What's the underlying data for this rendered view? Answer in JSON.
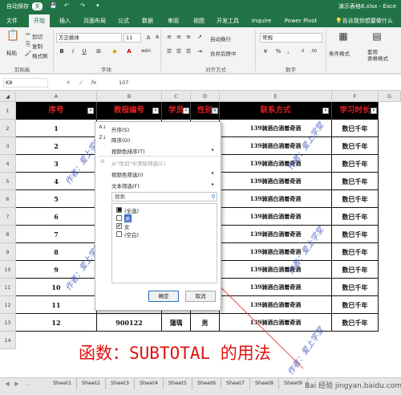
{
  "titlebar": {
    "autosave": "自动保存",
    "autosave_state": "关",
    "filename": "演示表格6.xlsx  -  Exce",
    "window": [
      "—",
      "□"
    ]
  },
  "ribbon_tabs": [
    "文件",
    "开始",
    "插入",
    "页面布局",
    "公式",
    "数据",
    "审阅",
    "视图",
    "开发工具",
    "Inquire",
    "Power Pivot"
  ],
  "active_tab": "开始",
  "tell_me": "告诉我你想要做什么",
  "ribbon": {
    "paste": "粘贴",
    "cut": "剪切",
    "copy": "复制",
    "format_painter": "格式刷",
    "clipboard": "剪贴板",
    "font_name": "方正姚体",
    "font_size": "11",
    "font_group": "字体",
    "wrap_text": "自动换行",
    "merge_center": "合并后居中",
    "align_group": "对齐方式",
    "number_format": "常规",
    "number_group": "数字",
    "conditional_format": "条件格式",
    "format_as_table": "套用\n表格格式",
    "bold": "B",
    "italic": "I",
    "underline": "U",
    "wen": "wén",
    "percent": "%",
    "comma": "，"
  },
  "formula_bar": {
    "name_box": "K8",
    "value": "107",
    "cancel": "✕",
    "enter": "✓",
    "fx": "fx"
  },
  "columns": [
    "A",
    "B",
    "C",
    "D",
    "E",
    "F",
    "G"
  ],
  "header_row": [
    "序号",
    "教程编号",
    "学员",
    "性别",
    "联系方式",
    "学习时长"
  ],
  "rows": [
    {
      "num": "1",
      "seq": "1",
      "contact": "139骑酒白酒着奇酒",
      "time": "数巳千年"
    },
    {
      "num": "2",
      "seq": "2",
      "contact": "139骑酒白酒着奇酒",
      "time": "数巳千年"
    },
    {
      "num": "3",
      "seq": "3",
      "contact": "139骑酒白酒着奇酒",
      "time": "数巳千年"
    },
    {
      "num": "4",
      "seq": "4",
      "contact": "139骑酒白酒着奇酒",
      "time": "数巳千年"
    },
    {
      "num": "5",
      "seq": "5",
      "contact": "139骑酒白酒着奇酒",
      "time": "数巳千年"
    },
    {
      "num": "6",
      "seq": "6",
      "contact": "139骑酒白酒着奇酒",
      "time": "数巳千年"
    },
    {
      "num": "7",
      "seq": "7",
      "contact": "139骑酒白酒着奇酒",
      "time": "数巳千年"
    },
    {
      "num": "8",
      "seq": "8",
      "contact": "139骑酒白酒着奇酒",
      "time": "数巳千年"
    },
    {
      "num": "9",
      "seq": "9",
      "contact": "139骑酒白酒着奇酒",
      "time": "数巳千年"
    },
    {
      "num": "10",
      "seq": "10",
      "contact": "139骑酒白酒着奇酒",
      "time": "数巳千年"
    },
    {
      "num": "11",
      "seq": "11",
      "contact": "139骑酒白酒着奇酒",
      "time": "数巳千年"
    },
    {
      "num": "12",
      "seq": "12",
      "code": "900122",
      "name": "蒲瑀",
      "gender": "男",
      "contact": "139骑酒白酒着奇酒",
      "time": "数巳千年"
    }
  ],
  "row_headers": [
    "1",
    "2",
    "3",
    "4",
    "5",
    "6",
    "7",
    "8",
    "9",
    "10",
    "11",
    "12",
    "13",
    "14"
  ],
  "filter_menu": {
    "sort_asc": "升序(S)",
    "sort_desc": "降序(O)",
    "sort_color": "按颜色排序(T)",
    "clear_filter": "从\"性别\"中清除筛选(C)",
    "filter_color": "按颜色筛选(I)",
    "text_filter": "文本筛选(F)",
    "search_placeholder": "搜索",
    "items": [
      {
        "label": "(全选)",
        "state": "partial"
      },
      {
        "label": "男",
        "state": "unchecked"
      },
      {
        "label": "女",
        "state": "checked"
      },
      {
        "label": "(空白)",
        "state": "unchecked"
      }
    ],
    "ok": "确定",
    "cancel": "取消"
  },
  "caption": "函数：SUBTOTAL 的用法",
  "watermark": "作者：爱上学堂",
  "sheet_tabs": [
    "Sheet1",
    "Sheet2",
    "Sheet3",
    "Sheet4",
    "Sheet5",
    "Sheet6",
    "Sheet7",
    "Sheet8",
    "Sheet9"
  ],
  "baidu": "Bai 经验 jingyan.baidu.com",
  "colors": {
    "excel_green": "#217346",
    "header_bg": "#000000",
    "header_text": "#e02020",
    "caption_red": "#e01010",
    "annotation_red": "#e02020"
  }
}
